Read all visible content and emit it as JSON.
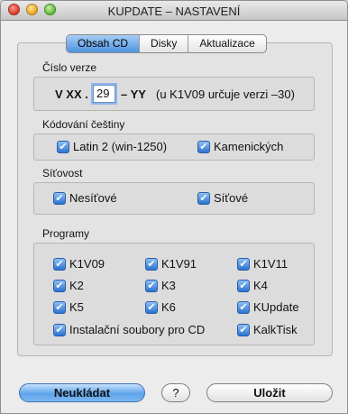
{
  "window": {
    "title": "KUPDATE – NASTAVENÍ"
  },
  "tabs": [
    {
      "label": "Obsah CD",
      "active": true
    },
    {
      "label": "Disky",
      "active": false
    },
    {
      "label": "Aktualizace",
      "active": false
    }
  ],
  "verze": {
    "heading": "Číslo verze",
    "prefix": "V XX .",
    "value": "29",
    "suffix": "– YY",
    "note": "(u K1V09 určuje verzi –30)"
  },
  "kodovani": {
    "heading": "Kódování češtiny",
    "items": [
      {
        "label": "Latin 2 (win-1250)",
        "checked": true
      },
      {
        "label": "Kamenických",
        "checked": true
      }
    ]
  },
  "sitovost": {
    "heading": "Síťovost",
    "items": [
      {
        "label": "Nesíťové",
        "checked": true
      },
      {
        "label": "Síťové",
        "checked": true
      }
    ]
  },
  "programy": {
    "heading": "Programy",
    "items": [
      {
        "label": "K1V09",
        "checked": true
      },
      {
        "label": "K1V91",
        "checked": true
      },
      {
        "label": "K1V11",
        "checked": true
      },
      {
        "label": "K2",
        "checked": true
      },
      {
        "label": "K3",
        "checked": true
      },
      {
        "label": "K4",
        "checked": true
      },
      {
        "label": "K5",
        "checked": true
      },
      {
        "label": "K6",
        "checked": true
      },
      {
        "label": "KUpdate",
        "checked": true
      },
      {
        "label": "Instalační soubory pro CD",
        "checked": true
      },
      {
        "label": "KalkTisk",
        "checked": true
      }
    ]
  },
  "buttons": {
    "neukladat": "Neukládat",
    "help": "?",
    "ulozit": "Uložit"
  },
  "icons": {
    "checkmark": "✔"
  },
  "colors": {
    "accent": "#4d93e0",
    "checkbox": "#2b73d1"
  }
}
